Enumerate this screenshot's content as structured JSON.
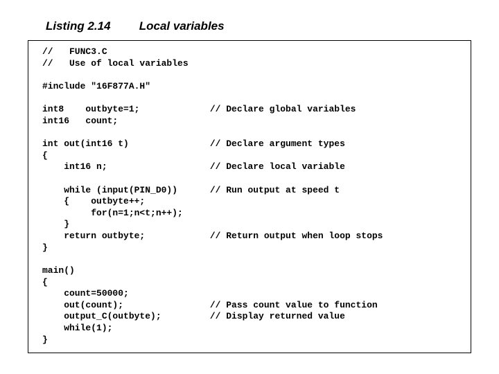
{
  "header": {
    "number": "Listing 2.14",
    "title": "Local variables"
  },
  "code": "//   FUNC3.C\n//   Use of local variables\n\n#include \"16F877A.H\"\n\nint8    outbyte=1;             // Declare global variables\nint16   count;\n\nint out(int16 t)               // Declare argument types\n{\n    int16 n;                   // Declare local variable\n\n    while (input(PIN_D0))      // Run output at speed t\n    {    outbyte++;\n         for(n=1;n<t;n++);\n    }\n    return outbyte;            // Return output when loop stops\n}\n\nmain()\n{\n    count=50000;\n    out(count);                // Pass count value to function\n    output_C(outbyte);         // Display returned value\n    while(1);\n}"
}
